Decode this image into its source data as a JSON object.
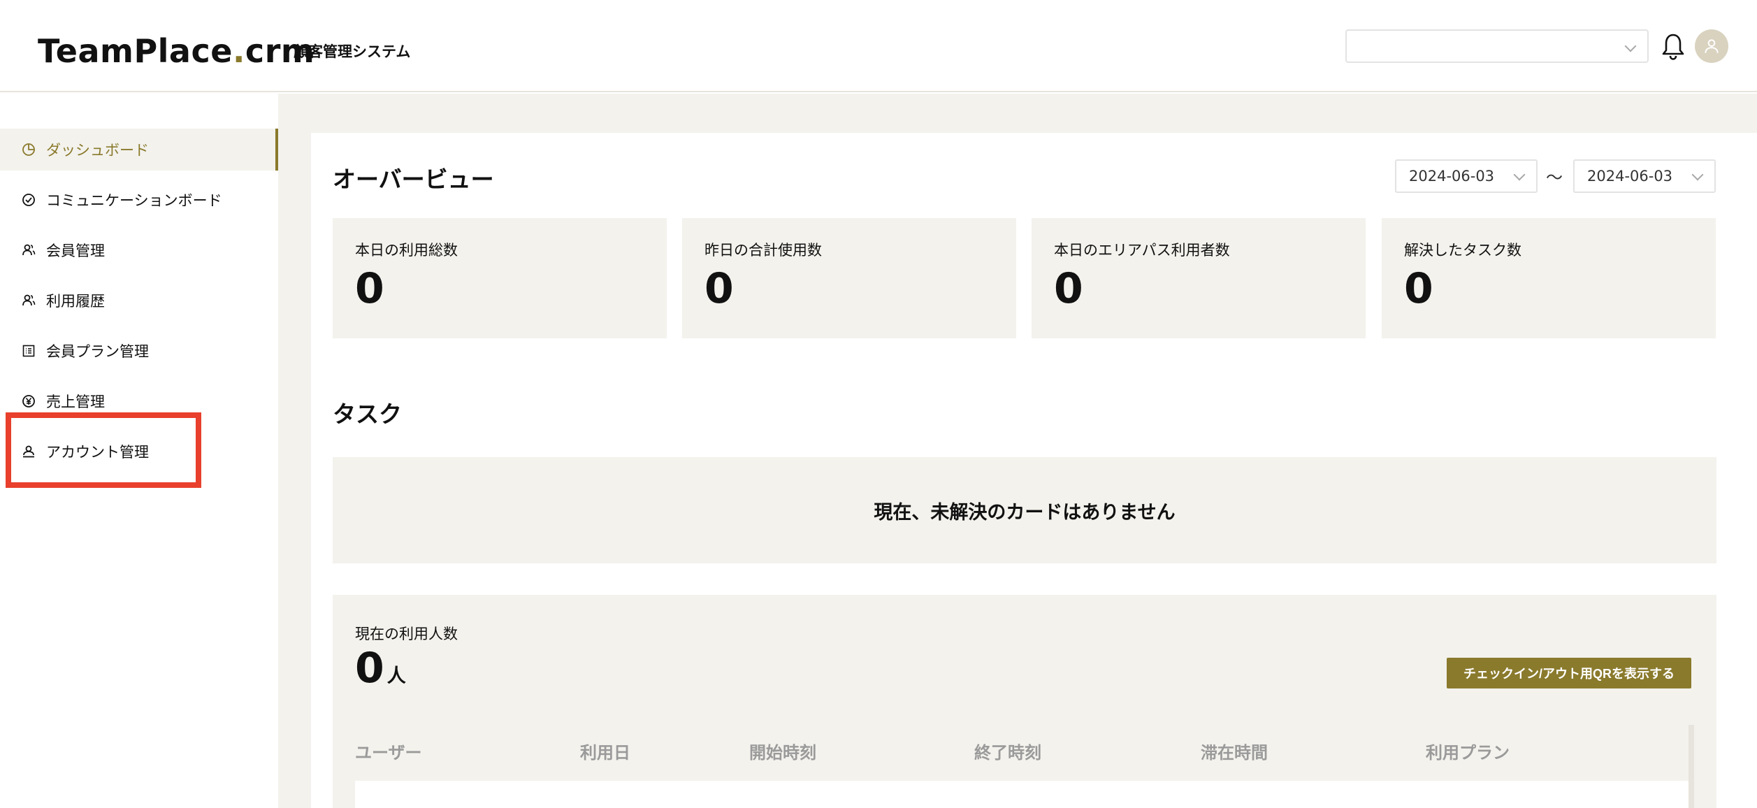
{
  "header": {
    "logo_main": "TeamPlace",
    "logo_dot": ".",
    "logo_suffix": "crm",
    "subtitle": "顧客管理システム",
    "select_value": ""
  },
  "sidebar": {
    "items": [
      {
        "label": "ダッシュボード",
        "icon": "pie-chart-icon",
        "active": true
      },
      {
        "label": "コミュニケーションボード",
        "icon": "check-circle-icon"
      },
      {
        "label": "会員管理",
        "icon": "users-icon"
      },
      {
        "label": "利用履歴",
        "icon": "users-icon"
      },
      {
        "label": "会員プラン管理",
        "icon": "list-icon"
      },
      {
        "label": "売上管理",
        "icon": "yen-circle-icon"
      },
      {
        "label": "アカウント管理",
        "icon": "account-icon"
      }
    ]
  },
  "overview": {
    "title": "オーバービュー",
    "date_from": "2024-06-03",
    "date_separator": "〜",
    "date_to": "2024-06-03",
    "stats": [
      {
        "label": "本日の利用総数",
        "value": "0"
      },
      {
        "label": "昨日の合計使用数",
        "value": "0"
      },
      {
        "label": "本日のエリアパス利用者数",
        "value": "0"
      },
      {
        "label": "解決したタスク数",
        "value": "0"
      }
    ]
  },
  "tasks": {
    "title": "タスク",
    "empty_message": "現在、未解決のカードはありません"
  },
  "usage": {
    "label": "現在の利用人数",
    "value": "0",
    "unit": "人",
    "qr_button": "チェックイン/アウト用QRを表示する",
    "columns": [
      "ユーザー",
      "利用日",
      "開始時刻",
      "終了時刻",
      "滞在時間",
      "利用プラン"
    ]
  },
  "colors": {
    "accent": "#8a7a2c",
    "background": "#f3f2ed",
    "highlight": "#e8402c"
  }
}
